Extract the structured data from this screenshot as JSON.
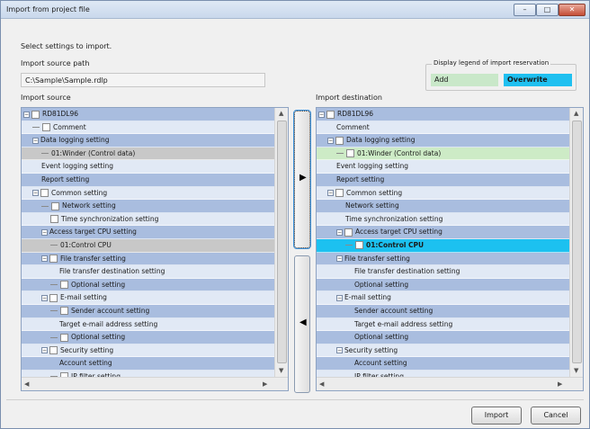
{
  "window": {
    "title": "Import from project file",
    "min": "–",
    "max": "□",
    "close": "✕"
  },
  "header": {
    "instruction": "Select settings to import.",
    "path_label": "Import source path",
    "path_value": "C:\\Sample\\Sample.rdlp"
  },
  "legend": {
    "title": "Display legend of import reservation",
    "add": "Add",
    "overwrite": "Overwrite",
    "add_color": "#c9e8c9",
    "overwrite_color": "#1fc0f0"
  },
  "source": {
    "label": "Import source"
  },
  "destination": {
    "label": "Import destination"
  },
  "buttons": {
    "import": "Import",
    "cancel": "Cancel",
    "add_arrow": "▶",
    "remove_arrow": "◀"
  }
}
